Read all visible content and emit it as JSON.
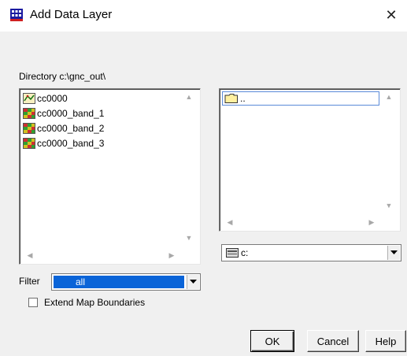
{
  "window": {
    "title": "Add Data Layer",
    "close_glyph": "✕"
  },
  "directory": {
    "label": "Directory c:\\gnc_out\\"
  },
  "files": [
    {
      "name": "cc0000",
      "icon": "vector-layer-icon"
    },
    {
      "name": "cc0000_band_1",
      "icon": "raster-layer-icon"
    },
    {
      "name": "cc0000_band_2",
      "icon": "raster-layer-icon"
    },
    {
      "name": "cc0000_band_3",
      "icon": "raster-layer-icon"
    }
  ],
  "folders": {
    "selected": ".."
  },
  "drive": {
    "value": "c:"
  },
  "filter": {
    "label": "Filter",
    "value": "all"
  },
  "options": {
    "extend_label": "Extend Map Boundaries",
    "extend_checked": false
  },
  "buttons": {
    "ok": "OK",
    "cancel": "Cancel",
    "help": "Help"
  },
  "colors": {
    "selection": "#0a64d8",
    "dialog_bg": "#f0f0f0"
  }
}
